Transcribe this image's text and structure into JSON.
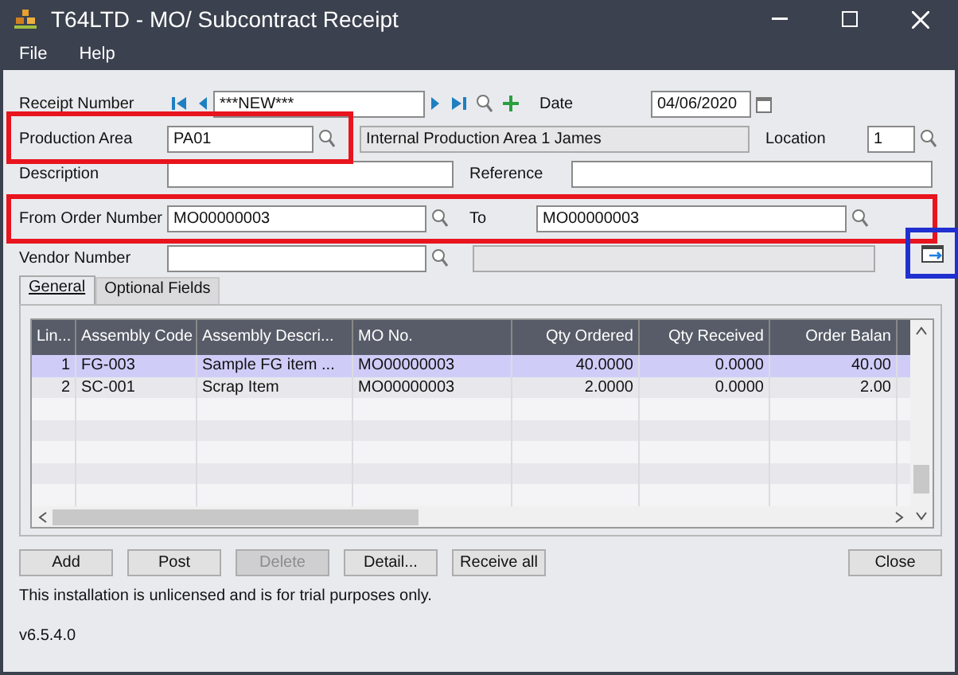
{
  "window": {
    "title": "T64LTD - MO/ Subcontract Receipt"
  },
  "menu": [
    "File",
    "Help"
  ],
  "receipt_number": {
    "label": "Receipt Number",
    "value": "***NEW***"
  },
  "date": {
    "label": "Date",
    "value": "04/06/2020"
  },
  "production_area": {
    "label": "Production Area",
    "value": "PA01",
    "description": "Internal Production Area 1 James",
    "highlighted": true
  },
  "location": {
    "label": "Location",
    "value": "1"
  },
  "description": {
    "label": "Description"
  },
  "reference": {
    "label": "Reference"
  },
  "order_range": {
    "from_label": "From Order Number",
    "from_value": "MO00000003",
    "to_label": "To",
    "to_value": "MO00000003",
    "highlighted": true
  },
  "vendor_number": {
    "label": "Vendor Number"
  },
  "export_button": {
    "highlighted": true
  },
  "tabs": [
    {
      "label": "General",
      "selected": true
    },
    {
      "label": "Optional Fields",
      "selected": false
    }
  ],
  "table": {
    "columns": [
      "Lin...",
      "Assembly Code",
      "Assembly Descri...",
      "MO No.",
      "Qty Ordered",
      "Qty Received",
      "Order Balan"
    ],
    "rows": [
      {
        "cells": [
          "1",
          "FG-003",
          "Sample FG item ...",
          "MO00000003",
          "40.0000",
          "0.0000",
          "40.00"
        ],
        "selected": true
      },
      {
        "cells": [
          "2",
          "SC-001",
          "Scrap Item",
          "MO00000003",
          "2.0000",
          "0.0000",
          "2.00"
        ],
        "selected": false
      }
    ]
  },
  "buttons": [
    {
      "label": "Add",
      "disabled": false
    },
    {
      "label": "Post",
      "disabled": false
    },
    {
      "label": "Delete",
      "disabled": true
    },
    {
      "label": "Detail...",
      "disabled": false
    },
    {
      "label": "Receive all",
      "disabled": false
    }
  ],
  "close_button": "Close",
  "notice": "This installation is unlicensed and is for trial purposes only.",
  "version": "v6.5.4.0"
}
